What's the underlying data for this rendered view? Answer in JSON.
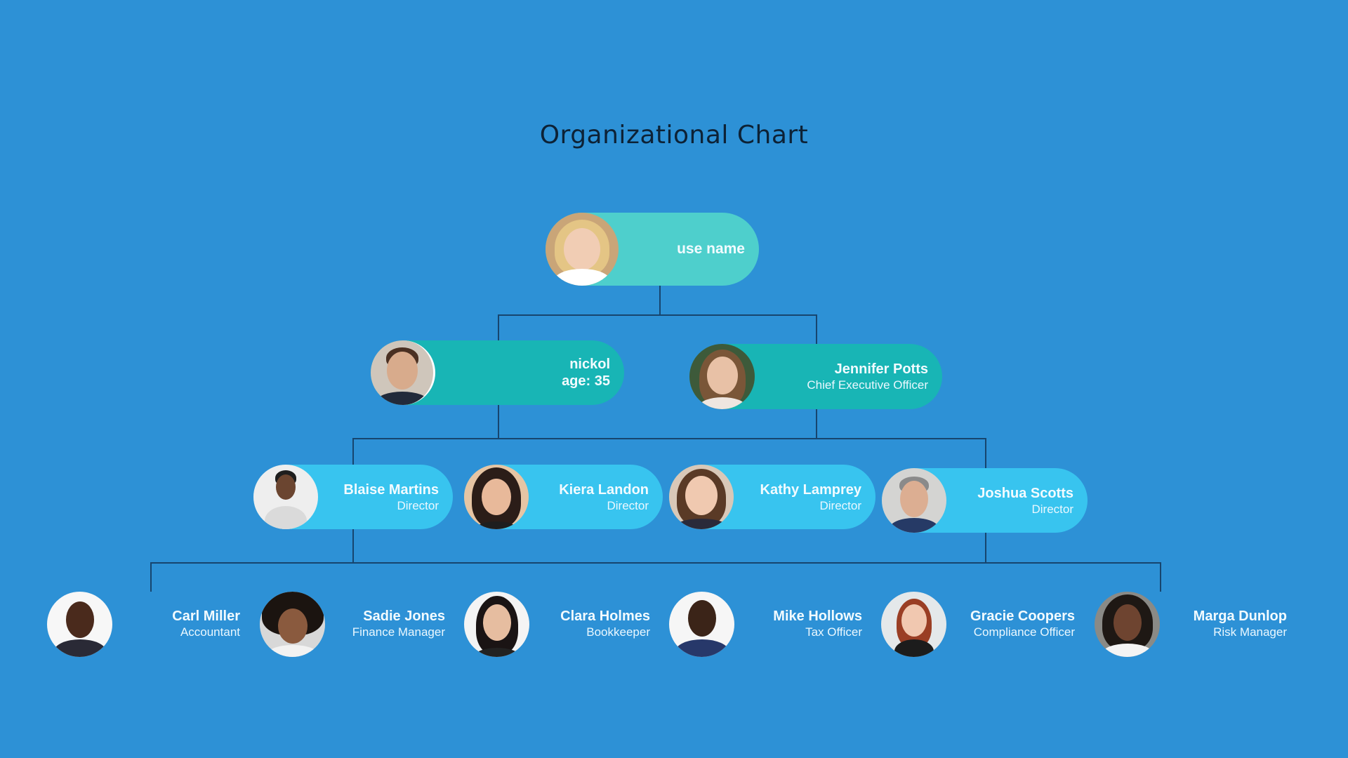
{
  "title": "Organizational Chart",
  "colors": {
    "background": "#2d91d6",
    "root_pill": "#4ecfcc",
    "level2_pill": "#18b5b5",
    "level3_pill": "#38c4ef",
    "connector": "#17456e",
    "title_text": "#0d2236"
  },
  "root": {
    "name": "use name",
    "avatar_icon": "person-photo-icon"
  },
  "level2": [
    {
      "name": "nickol",
      "role": "age: 35",
      "avatar_icon": "person-photo-icon"
    },
    {
      "name": "Jennifer Potts",
      "role": "Chief Executive Officer",
      "avatar_icon": "person-photo-icon"
    }
  ],
  "level3": [
    {
      "name": "Blaise Martins",
      "role": "Director",
      "avatar_icon": "person-photo-icon"
    },
    {
      "name": "Kiera Landon",
      "role": "Director",
      "avatar_icon": "person-photo-icon"
    },
    {
      "name": "Kathy Lamprey",
      "role": "Director",
      "avatar_icon": "person-photo-icon"
    },
    {
      "name": "Joshua Scotts",
      "role": "Director",
      "avatar_icon": "person-photo-icon"
    }
  ],
  "level4": [
    {
      "name": "Carl Miller",
      "role": "Accountant",
      "avatar_icon": "person-photo-icon"
    },
    {
      "name": "Sadie Jones",
      "role": "Finance Manager",
      "avatar_icon": "person-photo-icon"
    },
    {
      "name": "Clara Holmes",
      "role": "Bookkeeper",
      "avatar_icon": "person-photo-icon"
    },
    {
      "name": "Mike Hollows",
      "role": "Tax Officer",
      "avatar_icon": "person-photo-icon"
    },
    {
      "name": "Gracie Coopers",
      "role": "Compliance Officer",
      "avatar_icon": "person-photo-icon"
    },
    {
      "name": "Marga Dunlop",
      "role": "Risk Manager",
      "avatar_icon": "person-photo-icon"
    }
  ]
}
